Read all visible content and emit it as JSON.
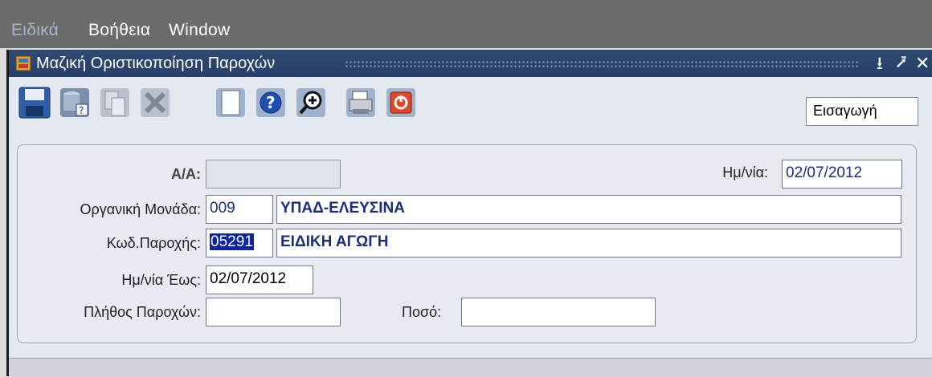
{
  "menubar": {
    "items": [
      {
        "label": "Ειδικά",
        "enabled": false
      },
      {
        "label": "Βοήθεια",
        "enabled": true
      },
      {
        "label": "Window",
        "enabled": true
      }
    ]
  },
  "window": {
    "title": "Μαζική Οριστικοποίηση Παροχών",
    "controls": {
      "minimize": "⭳",
      "maximize": "⭷",
      "close": "✕"
    }
  },
  "toolbar": {
    "buttons": [
      "save-icon",
      "query-database-icon",
      "copy-record-icon",
      "delete-record-icon",
      "new-document-icon",
      "help-icon",
      "zoom-in-icon",
      "print-icon",
      "exit-icon"
    ],
    "mode": "Εισαγωγή"
  },
  "form": {
    "aa": {
      "label": "Α/Α:",
      "value": ""
    },
    "date": {
      "label": "Ημ/νία:",
      "value": "02/07/2012"
    },
    "org_unit": {
      "label": "Οργανική Μονάδα:",
      "code": "009",
      "name": "ΥΠΑΔ-ΕΛΕΥΣΙΝΑ"
    },
    "benefit_code": {
      "label": "Κωδ.Παροχής:",
      "code": "05291",
      "name": "ΕΙΔΙΚΗ ΑΓΩΓΗ"
    },
    "date_until": {
      "label": "Ημ/νία Έως:",
      "value": "02/07/2012"
    },
    "benefit_count": {
      "label": "Πλήθος Παροχών:",
      "value": ""
    },
    "amount": {
      "label": "Ποσό:",
      "value": ""
    }
  },
  "colors": {
    "menubar": "#6b6b6b",
    "titlebar": "#2e4b74",
    "selection": "#0b24a8",
    "panel": "#e7eaf0"
  }
}
